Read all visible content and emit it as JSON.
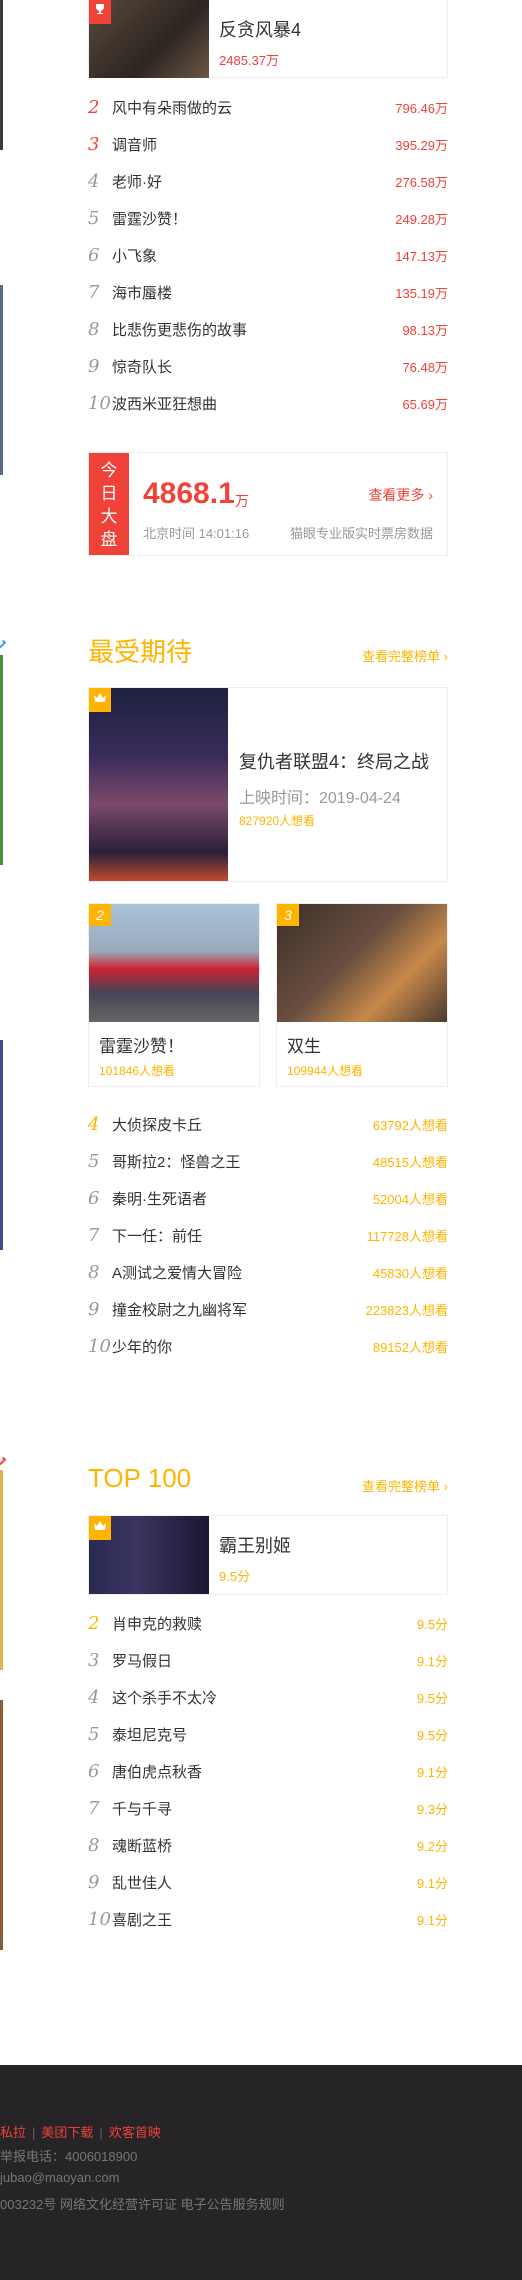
{
  "colors": {
    "red": "#ef4238",
    "orange": "#ffb400",
    "grey": "#999999",
    "footer_bg": "#262426"
  },
  "box_office": {
    "top": {
      "rank_icon": "trophy-icon",
      "title": "反贪风暴4",
      "value": "2485.37万"
    },
    "list": [
      {
        "rank": "2",
        "title": "风中有朵雨做的云",
        "value": "796.46万"
      },
      {
        "rank": "3",
        "title": "调音师",
        "value": "395.29万"
      },
      {
        "rank": "4",
        "title": "老师·好",
        "value": "276.58万"
      },
      {
        "rank": "5",
        "title": "雷霆沙赞！",
        "value": "249.28万"
      },
      {
        "rank": "6",
        "title": "小飞象",
        "value": "147.13万"
      },
      {
        "rank": "7",
        "title": "海市蜃楼",
        "value": "135.19万"
      },
      {
        "rank": "8",
        "title": "比悲伤更悲伤的故事",
        "value": "98.13万"
      },
      {
        "rank": "9",
        "title": "惊奇队长",
        "value": "76.48万"
      },
      {
        "rank": "10",
        "title": "波西米亚狂想曲",
        "value": "65.69万"
      }
    ],
    "today": {
      "label_1": "今",
      "label_2": "日",
      "label_3": "大",
      "label_4": "盘",
      "amount": "4868.1",
      "unit": "万",
      "more": "查看更多",
      "time": "北京时间 14:01:16",
      "source": "猫眼专业版实时票房数据"
    }
  },
  "expected": {
    "title": "最受期待",
    "link": "查看完整榜单",
    "top": {
      "title": "复仇者联盟4：终局之战",
      "release": "上映时间：2019-04-24",
      "wish": "827920人想看"
    },
    "second": {
      "rank": "2",
      "title": "雷霆沙赞！",
      "wish": "101846人想看"
    },
    "third": {
      "rank": "3",
      "title": "双生",
      "wish": "109944人想看"
    },
    "list": [
      {
        "rank": "4",
        "title": "大侦探皮卡丘",
        "wish": "63792人想看"
      },
      {
        "rank": "5",
        "title": "哥斯拉2：怪兽之王",
        "wish": "48515人想看"
      },
      {
        "rank": "6",
        "title": "秦明·生死语者",
        "wish": "52004人想看"
      },
      {
        "rank": "7",
        "title": "下一任：前任",
        "wish": "117728人想看"
      },
      {
        "rank": "8",
        "title": "A测试之爱情大冒险",
        "wish": "45830人想看"
      },
      {
        "rank": "9",
        "title": "撞金校尉之九幽将军",
        "wish": "223823人想看"
      },
      {
        "rank": "10",
        "title": "少年的你",
        "wish": "89152人想看"
      }
    ]
  },
  "top100": {
    "title": "TOP 100",
    "link": "查看完整榜单",
    "top": {
      "title": "霸王别姬",
      "score": "9.5分"
    },
    "list": [
      {
        "rank": "2",
        "title": "肖申克的救赎",
        "score": "9.5分"
      },
      {
        "rank": "3",
        "title": "罗马假日",
        "score": "9.1分"
      },
      {
        "rank": "4",
        "title": "这个杀手不太冷",
        "score": "9.5分"
      },
      {
        "rank": "5",
        "title": "泰坦尼克号",
        "score": "9.5分"
      },
      {
        "rank": "6",
        "title": "唐伯虎点秋香",
        "score": "9.1分"
      },
      {
        "rank": "7",
        "title": "千与千寻",
        "score": "9.3分"
      },
      {
        "rank": "8",
        "title": "魂断蓝桥",
        "score": "9.2分"
      },
      {
        "rank": "9",
        "title": "乱世佳人",
        "score": "9.1分"
      },
      {
        "rank": "10",
        "title": "喜剧之王",
        "score": "9.1分"
      }
    ]
  },
  "footer": {
    "link_1": "私拉",
    "link_2": "美团下载",
    "link_3": "欢客首映",
    "line_1": "举报电话：4006018900",
    "line_2": "jubao@maoyan.com",
    "line_3": "003232号 网络文化经营许可证 电子公告服务规则"
  }
}
